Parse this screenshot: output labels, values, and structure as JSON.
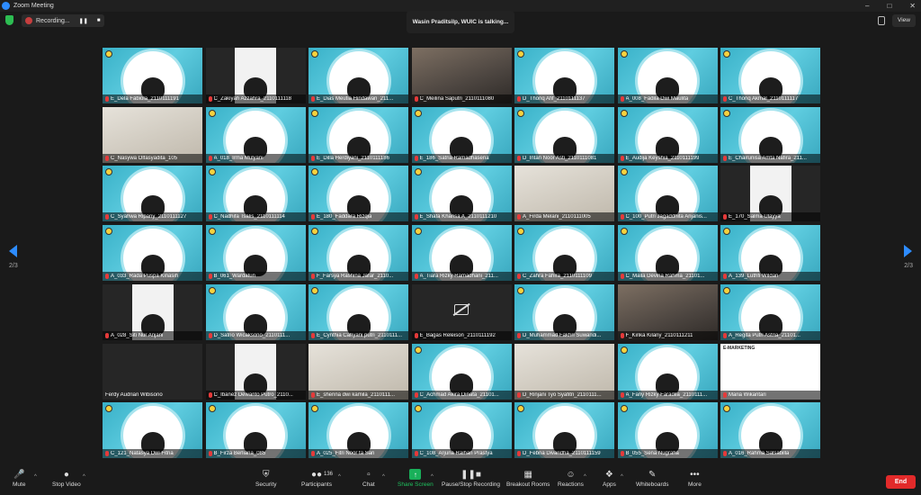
{
  "window": {
    "title": "Zoom Meeting"
  },
  "recording": {
    "label": "Recording...",
    "pause_glyph": "❚❚",
    "stop_glyph": "■"
  },
  "speaker": {
    "talking_text": "Wasin Praditsilp, WUIC is talking..."
  },
  "view": {
    "label": "View"
  },
  "pagination": {
    "left": "2/3",
    "right": "2/3"
  },
  "tiles": [
    {
      "name": "E_Dela Fabiola_2110111191",
      "kind": "avatar"
    },
    {
      "name": "C_Zakiyah Azzahra_2110111118",
      "kind": "portrait"
    },
    {
      "name": "E_Dias Meutia Hindawan_211...",
      "kind": "avatar"
    },
    {
      "name": "C_Meilina Saputri_2110111080",
      "kind": "cam"
    },
    {
      "name": "D_Thoriq Afif_2110111137",
      "kind": "avatar"
    },
    {
      "name": "A_008_Fadila Dwi Maulita",
      "kind": "avatar"
    },
    {
      "name": "C_Thoriq Akmal_2110111117",
      "kind": "avatar"
    },
    {
      "name": "C_Nasywa Olfasyadita_105",
      "kind": "cam-light"
    },
    {
      "name": "A_018_Irma Mulyani",
      "kind": "avatar"
    },
    {
      "name": "E_Dilla Herdiyani_2110111186",
      "kind": "avatar"
    },
    {
      "name": "E_186_Satria Ramadhasena",
      "kind": "avatar"
    },
    {
      "name": "D_Intan Noor Asti_2110111081",
      "kind": "avatar"
    },
    {
      "name": "E_Audija Keyshia_2110111199",
      "kind": "avatar"
    },
    {
      "name": "E_Chairunisa Amta Nafira_211...",
      "kind": "avatar"
    },
    {
      "name": "C_Syahwa Ripany_2110111127",
      "kind": "avatar"
    },
    {
      "name": "C_Nadhifa Tsalis_2110111114",
      "kind": "avatar"
    },
    {
      "name": "E_180_Faddara Rizqia",
      "kind": "avatar"
    },
    {
      "name": "E_Shafa Khansa A_2110111210",
      "kind": "avatar"
    },
    {
      "name": "A_Firda Melani_2110111005",
      "kind": "cam-light"
    },
    {
      "name": "C_100_Putri Jagaddhita Anjanis...",
      "kind": "avatar"
    },
    {
      "name": "E_170_Salma Ulayya",
      "kind": "portrait"
    },
    {
      "name": "A_033_Rada Puspa Kinasih",
      "kind": "avatar"
    },
    {
      "name": "B_061_Wardatun",
      "kind": "avatar"
    },
    {
      "name": "F_Farsya Rashina Jafar_2110...",
      "kind": "avatar"
    },
    {
      "name": "A_Tiara Rizky Ramadhani_211...",
      "kind": "avatar"
    },
    {
      "name": "C_Zahra Fahira_2110111109",
      "kind": "avatar"
    },
    {
      "name": "C_Maila Devina Rahma_21101...",
      "kind": "avatar"
    },
    {
      "name": "A_139_Luthfi Wildan",
      "kind": "avatar"
    },
    {
      "name": "A_028_Siti Nur Anjani",
      "kind": "portrait"
    },
    {
      "name": "D_Satrio Wicaksono_2110111...",
      "kind": "avatar"
    },
    {
      "name": "E_Cynthia Cahyani putri_2110111...",
      "kind": "avatar"
    },
    {
      "name": "E_Bagas Releison_2110111192",
      "kind": "videooff"
    },
    {
      "name": "D_Muhammad Fakhri Suwandi...",
      "kind": "avatar"
    },
    {
      "name": "F_Kirika Kilany_2110111211",
      "kind": "cam"
    },
    {
      "name": "A_Regita Putri Astria_21101...",
      "kind": "avatar"
    },
    {
      "name": "Ferdy Audrian Wibisono",
      "kind": "dark"
    },
    {
      "name": "C_Ibanez Dewanto Putro_2110...",
      "kind": "portrait"
    },
    {
      "name": "E_sherina dwi kamila_2110111...",
      "kind": "cam-light"
    },
    {
      "name": "C_Achmad Akira Dinata_21101...",
      "kind": "avatar"
    },
    {
      "name": "D_Rinjani Tyo Syafitri_2110111...",
      "kind": "cam-light"
    },
    {
      "name": "A_Fany Rizky Faradila_2110111...",
      "kind": "avatar"
    },
    {
      "name": "Maria Wikantari",
      "kind": "slide",
      "slide_title": "E-MARKETING"
    },
    {
      "name": "C_121_Natasya Dwi Fitria",
      "kind": "avatar"
    },
    {
      "name": "B_Firza Berliana_085",
      "kind": "avatar"
    },
    {
      "name": "A_025_Fitri Noor ta Sari",
      "kind": "avatar"
    },
    {
      "name": "C_108_Arjuna Raihan Prastya",
      "kind": "avatar"
    },
    {
      "name": "D_Febria Divaridha_2110111159",
      "kind": "avatar"
    },
    {
      "name": "B_055_Sena Nugraha",
      "kind": "avatar"
    },
    {
      "name": "A_016_Rahma Salsabilla",
      "kind": "avatar"
    }
  ],
  "toolbar": {
    "mute": "Mute",
    "stop_video": "Stop Video",
    "security": "Security",
    "participants": "Participants",
    "participants_count": "136",
    "chat": "Chat",
    "share_screen": "Share Screen",
    "pause_recording": "Pause/Stop Recording",
    "breakout_rooms": "Breakout Rooms",
    "reactions": "Reactions",
    "apps": "Apps",
    "whiteboards": "Whiteboards",
    "more": "More",
    "end": "End"
  },
  "colors": {
    "accent": "#2d8cff",
    "end": "#e22a2a",
    "share": "#19b05a",
    "tile": "#4ebfd4"
  }
}
